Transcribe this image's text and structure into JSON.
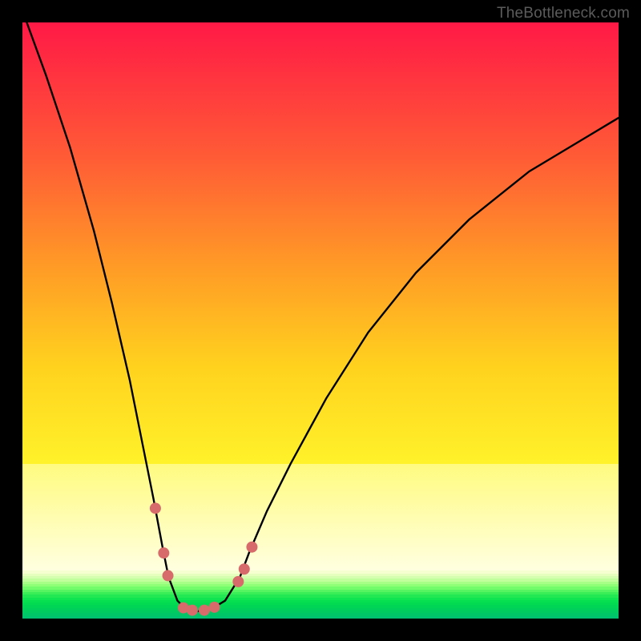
{
  "watermark": "TheBottleneck.com",
  "chart_data": {
    "type": "line",
    "title": "",
    "xlabel": "",
    "ylabel": "",
    "xlim": [
      0,
      100
    ],
    "ylim": [
      0,
      100
    ],
    "series": [
      {
        "name": "bottleneck-curve",
        "x": [
          0,
          4,
          8,
          12,
          15,
          18,
          20,
          22,
          23.5,
          24.5,
          26,
          27.5,
          29,
          30.5,
          32,
          34,
          36.5,
          38,
          41,
          45,
          51,
          58,
          66,
          75,
          85,
          95,
          100
        ],
        "values": [
          102,
          91,
          79,
          65,
          53,
          40,
          30,
          20,
          12,
          7,
          3,
          1.5,
          1.2,
          1.3,
          1.8,
          3,
          7,
          11,
          18,
          26,
          37,
          48,
          58,
          67,
          75,
          81,
          84
        ]
      }
    ],
    "markers": [
      {
        "x": 22.3,
        "y": 18.5
      },
      {
        "x": 23.7,
        "y": 11.0
      },
      {
        "x": 24.4,
        "y": 7.2
      },
      {
        "x": 27.0,
        "y": 1.8
      },
      {
        "x": 28.5,
        "y": 1.4
      },
      {
        "x": 30.5,
        "y": 1.4
      },
      {
        "x": 32.2,
        "y": 1.9
      },
      {
        "x": 36.2,
        "y": 6.2
      },
      {
        "x": 37.2,
        "y": 8.3
      },
      {
        "x": 38.5,
        "y": 12.0
      }
    ],
    "marker_radius": 7,
    "marker_color": "#d76b6b",
    "background_gradient": {
      "top_band": {
        "from": "#ff1946",
        "to": "#fff22a",
        "y0": 0,
        "y1": 74
      },
      "pale_band": {
        "from": "#fffb80",
        "to": "#ffffe0",
        "y0": 74,
        "y1": 92
      },
      "green_stripes": [
        "#f6ffcf",
        "#e6ffbe",
        "#d4ffae",
        "#c0ff9b",
        "#a8ff88",
        "#8eff77",
        "#72fb6a",
        "#56f460",
        "#3aee58",
        "#22e953",
        "#10e450",
        "#06df50",
        "#02da52",
        "#00d556",
        "#00d05b",
        "#00cb61",
        "#00c668",
        "#00c16f"
      ],
      "green_y0": 92,
      "green_y1": 100
    }
  }
}
